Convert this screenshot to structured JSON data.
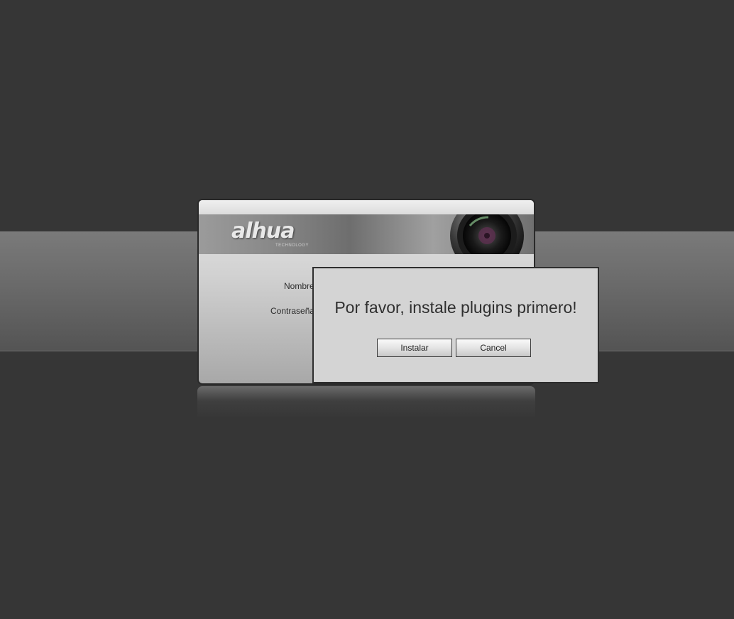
{
  "brand": {
    "logo_text": "alhua",
    "logo_sub": "TECHNOLOGY"
  },
  "login": {
    "username_label": "Nombre",
    "password_label": "Contraseña"
  },
  "dialog": {
    "message": "Por favor, instale plugins primero!",
    "install_label": "Instalar",
    "cancel_label": "Cancel"
  },
  "icons": {
    "camera_lens": "camera-lens-icon"
  },
  "colors": {
    "background": "#363636",
    "band": "#6a6a6a",
    "dialog": "#d4d4d4"
  }
}
